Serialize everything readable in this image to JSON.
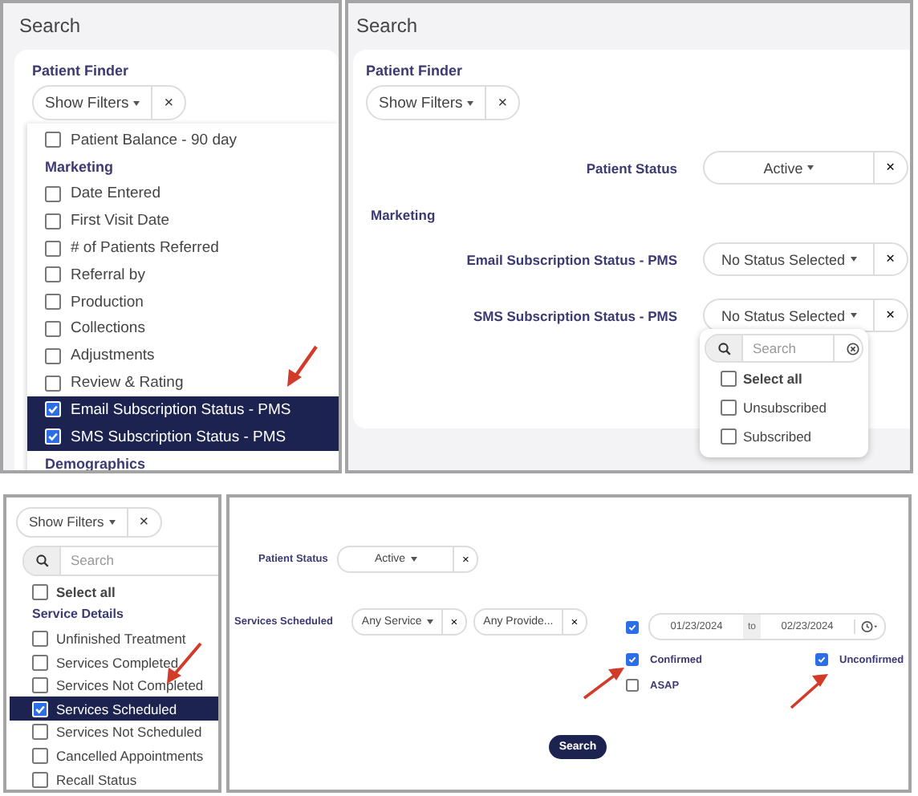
{
  "top_left": {
    "title": "Search",
    "section": "Patient Finder",
    "filter_button": "Show Filters",
    "clear": "×",
    "list": [
      {
        "kind": "option",
        "label": "Patient Balance - 90 day",
        "checked": false
      },
      {
        "kind": "heading",
        "label": "Marketing"
      },
      {
        "kind": "option",
        "label": "Date Entered",
        "checked": false
      },
      {
        "kind": "option",
        "label": "First Visit Date",
        "checked": false
      },
      {
        "kind": "option",
        "label": "# of Patients Referred",
        "checked": false
      },
      {
        "kind": "option",
        "label": "Referral by",
        "checked": false
      },
      {
        "kind": "option",
        "label": "Production",
        "checked": false
      },
      {
        "kind": "option",
        "label": "Collections",
        "checked": false
      },
      {
        "kind": "option",
        "label": "Adjustments",
        "checked": false
      },
      {
        "kind": "option",
        "label": "Review & Rating",
        "checked": false
      },
      {
        "kind": "option",
        "label": "Email Subscription Status - PMS",
        "checked": true
      },
      {
        "kind": "option",
        "label": "SMS Subscription Status - PMS",
        "checked": true
      },
      {
        "kind": "heading",
        "label": "Demographics"
      }
    ]
  },
  "top_right": {
    "title": "Search",
    "section": "Patient Finder",
    "filter_button": "Show Filters",
    "clear": "×",
    "rows": [
      {
        "kind": "field",
        "label": "Patient Status",
        "value": "Active",
        "clear": "×"
      },
      {
        "kind": "heading",
        "label": "Marketing"
      },
      {
        "kind": "field",
        "label": "Email Subscription Status - PMS",
        "value": "No Status Selected",
        "clear": "×"
      },
      {
        "kind": "field",
        "label": "SMS Subscription Status - PMS",
        "value": "No Status Selected",
        "clear": "×"
      }
    ],
    "popup": {
      "search_placeholder": "Search",
      "options": [
        {
          "kind": "all",
          "label": "Select all",
          "checked": false
        },
        {
          "kind": "option",
          "label": "Unsubscribed",
          "checked": false
        },
        {
          "kind": "option",
          "label": "Subscribed",
          "checked": false
        }
      ]
    }
  },
  "bottom_left": {
    "filter_button": "Show Filters",
    "clear": "×",
    "search_placeholder": "Search",
    "list": [
      {
        "kind": "all",
        "label": "Select all",
        "checked": false
      },
      {
        "kind": "heading",
        "label": "Service Details"
      },
      {
        "kind": "option",
        "label": "Unfinished Treatment",
        "checked": false
      },
      {
        "kind": "option",
        "label": "Services Completed",
        "checked": false
      },
      {
        "kind": "option",
        "label": "Services Not Completed",
        "checked": false
      },
      {
        "kind": "option",
        "label": "Services Scheduled",
        "checked": true
      },
      {
        "kind": "option",
        "label": "Services Not Scheduled",
        "checked": false
      },
      {
        "kind": "option",
        "label": "Cancelled Appointments",
        "checked": false
      },
      {
        "kind": "option",
        "label": "Recall Status",
        "checked": false
      }
    ]
  },
  "bottom_right": {
    "patient_status": {
      "label": "Patient Status",
      "value": "Active",
      "clear": "×"
    },
    "services": {
      "label": "Services Scheduled",
      "selects": [
        {
          "value": "Any Service",
          "caret": true,
          "clear": "×"
        },
        {
          "value": "Any Provide...",
          "caret": false,
          "clear": "×"
        }
      ]
    },
    "date_range": {
      "checked": true,
      "from": "01/23/2024",
      "separator": "to",
      "to": "02/23/2024"
    },
    "checks": [
      {
        "label": "Confirmed",
        "checked": true
      },
      {
        "label": "Unconfirmed",
        "checked": true
      },
      {
        "label": "ASAP",
        "checked": false
      }
    ],
    "search_button": "Search"
  }
}
